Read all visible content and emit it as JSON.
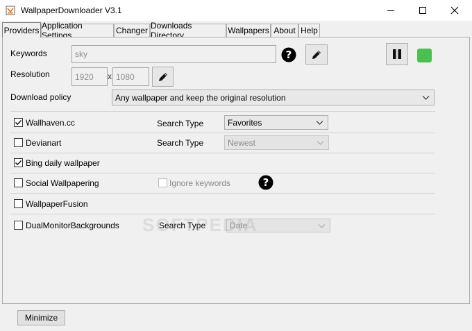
{
  "window": {
    "title": "WallpaperDownloader V3.1"
  },
  "tabs": [
    {
      "label": "Providers"
    },
    {
      "label": "Application Settings"
    },
    {
      "label": "Changer"
    },
    {
      "label": "Downloads Directory"
    },
    {
      "label": "Wallpapers"
    },
    {
      "label": "About"
    },
    {
      "label": "Help"
    }
  ],
  "keywords": {
    "label": "Keywords",
    "value": "sky"
  },
  "resolution": {
    "label": "Resolution",
    "width": "1920",
    "separator": "x",
    "height": "1080"
  },
  "download_policy": {
    "label": "Download policy",
    "value": "Any wallpaper and keep the original resolution"
  },
  "providers": {
    "wallhaven": {
      "label": "Wallhaven.cc",
      "checked": true,
      "search_type_label": "Search Type",
      "search_type": "Favorites"
    },
    "devianart": {
      "label": "Devianart",
      "checked": false,
      "search_type_label": "Search Type",
      "search_type": "Newest"
    },
    "bing": {
      "label": "Bing daily wallpaper",
      "checked": true
    },
    "social": {
      "label": "Social Wallpapering",
      "checked": false,
      "ignore_keywords_label": "Ignore keywords"
    },
    "fusion": {
      "label": "WallpaperFusion",
      "checked": false
    },
    "dualmonitor": {
      "label": "DualMonitorBackgrounds",
      "checked": false,
      "search_type_label": "Search Type",
      "search_type": "Date"
    }
  },
  "watermark": "SOFTPEDIA",
  "bottom": {
    "minimize_label": "Minimize"
  },
  "colors": {
    "status": "#4cbf50",
    "tab_border": "#adadad"
  }
}
